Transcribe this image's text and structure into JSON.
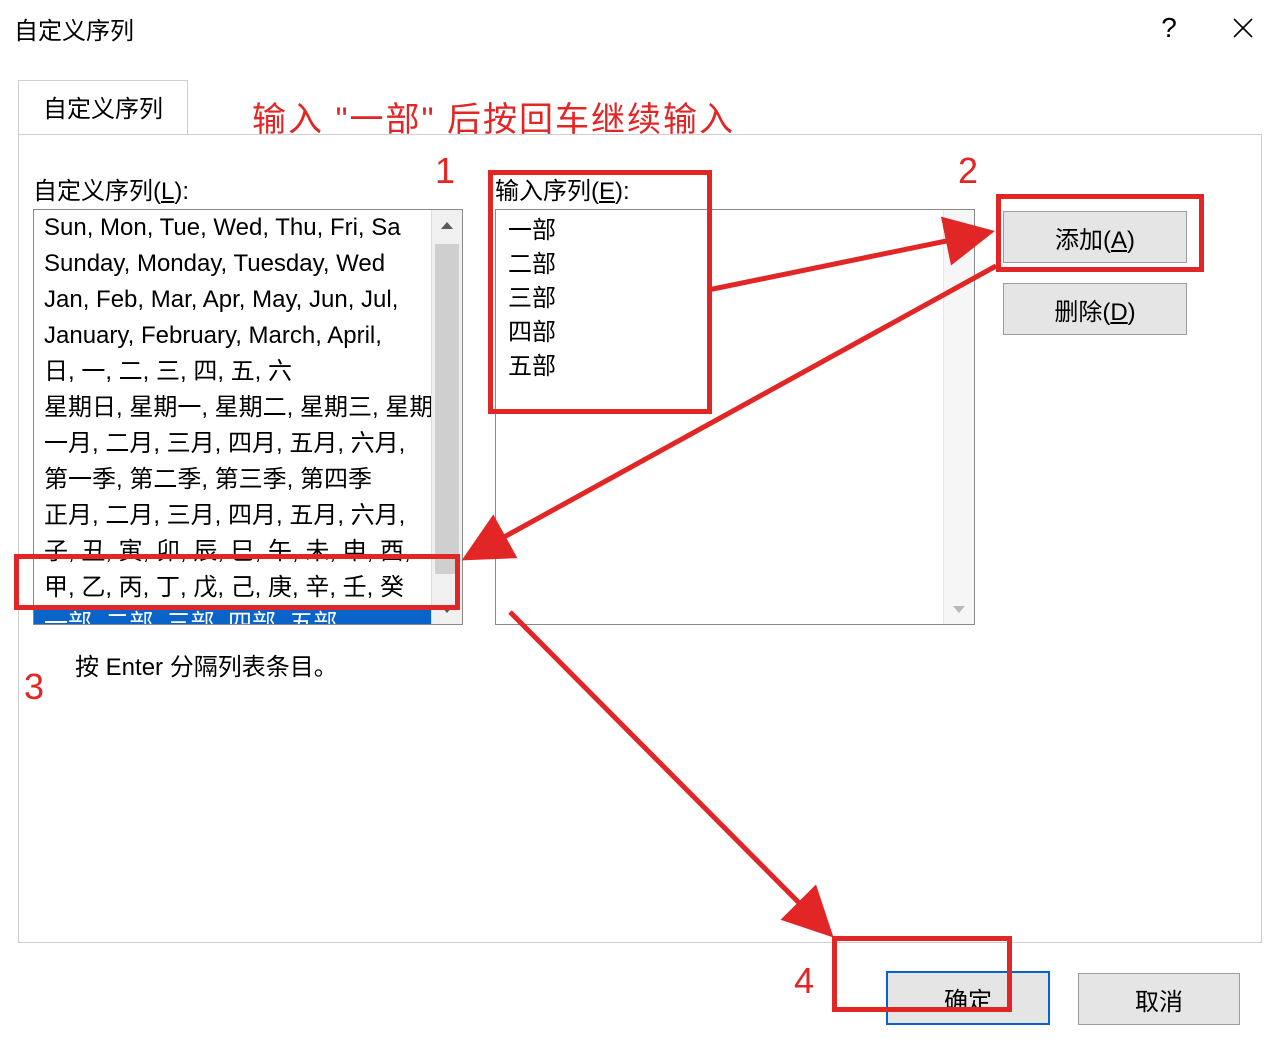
{
  "window": {
    "title": "自定义序列",
    "help_symbol": "?",
    "close_aria": "关闭"
  },
  "tab": {
    "label": "自定义序列"
  },
  "labels": {
    "custom_lists": "自定义序列(L):",
    "list_entries": "输入序列(E):",
    "hint": "按 Enter 分隔列表条目。"
  },
  "buttons": {
    "add": "添加(A)",
    "delete": "删除(D)",
    "ok": "确定",
    "cancel": "取消"
  },
  "custom_lists": [
    "Sun, Mon, Tue, Wed, Thu, Fri, Sa",
    "Sunday, Monday, Tuesday, Wed",
    "Jan, Feb, Mar, Apr, May, Jun, Jul,",
    "January, February, March, April,",
    "日, 一, 二, 三, 四, 五, 六",
    "星期日, 星期一, 星期二, 星期三, 星期",
    "一月, 二月, 三月, 四月, 五月, 六月, ",
    "第一季, 第二季, 第三季, 第四季",
    "正月, 二月, 三月, 四月, 五月, 六月, ",
    "子, 丑, 寅, 卯, 辰, 巳, 午, 未, 申, 酉, ",
    "甲, 乙, 丙, 丁, 戊, 己, 庚, 辛, 壬, 癸"
  ],
  "selected_list": "一部, 二部, 三部, 四部, 五部",
  "list_entries": [
    "一部",
    "二部",
    "三部",
    "四部",
    "五部"
  ],
  "annotations": {
    "instruction": "输入 \"一部\" 后按回车继续输入",
    "n1": "1",
    "n2": "2",
    "n3": "3",
    "n4": "4"
  }
}
